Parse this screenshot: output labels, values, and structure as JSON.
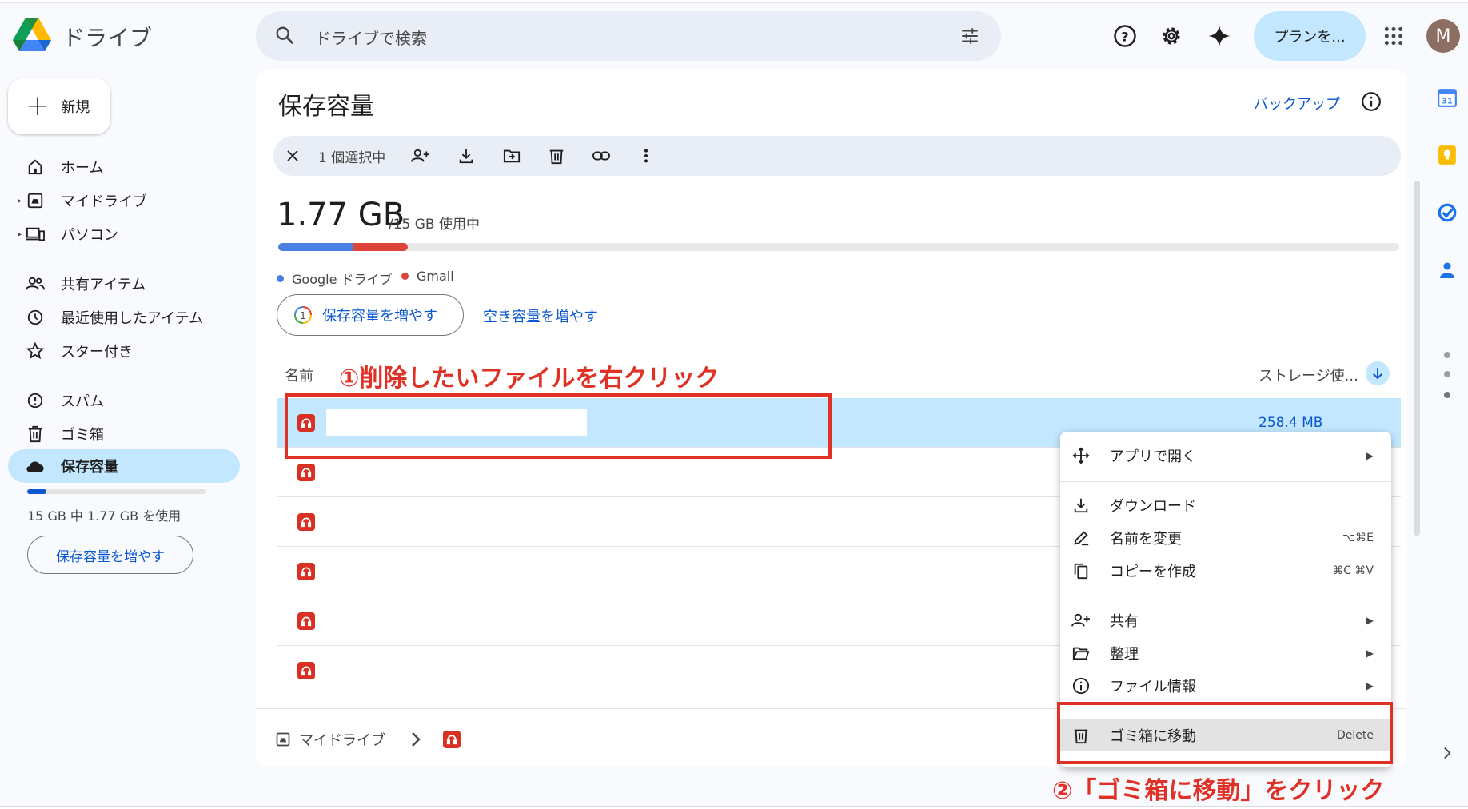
{
  "header": {
    "app_title": "ドライブ",
    "search_placeholder": "ドライブで検索",
    "plan_button": "プランを...",
    "avatar_initial": "M"
  },
  "sidebar": {
    "new_label": "新規",
    "items": [
      {
        "label": "ホーム",
        "icon": "home-icon"
      },
      {
        "label": "マイドライブ",
        "icon": "my-drive-icon"
      },
      {
        "label": "パソコン",
        "icon": "computers-icon"
      },
      {
        "label": "共有アイテム",
        "icon": "shared-icon"
      },
      {
        "label": "最近使用したアイテム",
        "icon": "clock-icon"
      },
      {
        "label": "スター付き",
        "icon": "star-icon"
      },
      {
        "label": "スパム",
        "icon": "spam-icon"
      },
      {
        "label": "ゴミ箱",
        "icon": "trash-icon"
      },
      {
        "label": "保存容量",
        "icon": "cloud-icon"
      }
    ],
    "usage_text": "15 GB 中 1.77 GB を使用",
    "usage_fraction": 0.118,
    "increase_button": "保存容量を増やす"
  },
  "main": {
    "title": "保存容量",
    "backup_link": "バックアップ",
    "selection_count": "1 個選択中",
    "used_big": "1.77 GB",
    "used_small": "/15 GB 使用中",
    "legend": [
      {
        "label": "Google ドライブ",
        "color": "#4a7fe3"
      },
      {
        "label": "Gmail",
        "color": "#db4437"
      }
    ],
    "increase_button": "保存容量を増やす",
    "free_space_link": "空き容量を増やす",
    "col_name": "名前",
    "col_storage": "ストレージ使...",
    "rows": [
      {
        "size": "258.4 MB",
        "selected": true
      },
      {
        "size": ""
      },
      {
        "size": ""
      },
      {
        "size": ""
      },
      {
        "size": ""
      },
      {
        "size": ""
      }
    ],
    "breadcrumb": "マイドライブ"
  },
  "context_menu": {
    "open_with": "アプリで開く",
    "download": "ダウンロード",
    "rename": "名前を変更",
    "rename_shortcut": "⌥⌘E",
    "copy": "コピーを作成",
    "copy_shortcut": "⌘C ⌘V",
    "share": "共有",
    "organize": "整理",
    "file_info": "ファイル情報",
    "move_to_trash": "ゴミ箱に移動",
    "trash_shortcut": "Delete"
  },
  "annotations": {
    "step1": "①削除したいファイルを右クリック",
    "step2": "②「ゴミ箱に移動」をクリック"
  },
  "colors": {
    "accent": "#0b57d0",
    "selected_bg": "#c2e7ff",
    "annotation_red": "#e03127"
  }
}
